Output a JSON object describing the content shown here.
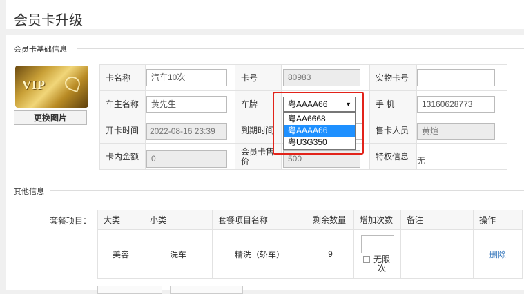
{
  "page": {
    "title": "会员卡升级"
  },
  "sections": {
    "basic": "会员卡基础信息",
    "other": "其他信息"
  },
  "card_image": {
    "text": "VIP",
    "change_button": "更换图片"
  },
  "form": {
    "card_name_label": "卡名称",
    "card_name": "汽车10次",
    "card_no_label": "卡号",
    "card_no": "80983",
    "physical_label": "实物卡号",
    "physical": "",
    "owner_label": "车主名称",
    "owner": "黄先生",
    "plate_label": "车牌",
    "plate_selected": "粤AAAA66",
    "plate_options": [
      "粤AA6668",
      "粤AAAA66",
      "粤U3G350"
    ],
    "phone_label": "手 机",
    "phone": "13160628773",
    "open_label": "开卡时间",
    "open_time": "2022-08-16 23:39",
    "expire_label": "到期时间",
    "expire_time": "",
    "seller_label": "售卡人员",
    "seller": "黄煊",
    "balance_label": "卡内金额",
    "balance": "0",
    "price_label": "会员卡售价",
    "price": "500",
    "privilege_label": "特权信息",
    "privilege": "无"
  },
  "package": {
    "label": "套餐项目：",
    "headers": [
      "大类",
      "小类",
      "套餐项目名称",
      "剩余数量",
      "增加次数",
      "备注",
      "操作"
    ],
    "rows": [
      {
        "category": "美容",
        "subcategory": "洗车",
        "item": "精洗（轿车）",
        "remaining": "9",
        "unlimited": "无限次",
        "note": "",
        "action": "删除"
      }
    ]
  }
}
